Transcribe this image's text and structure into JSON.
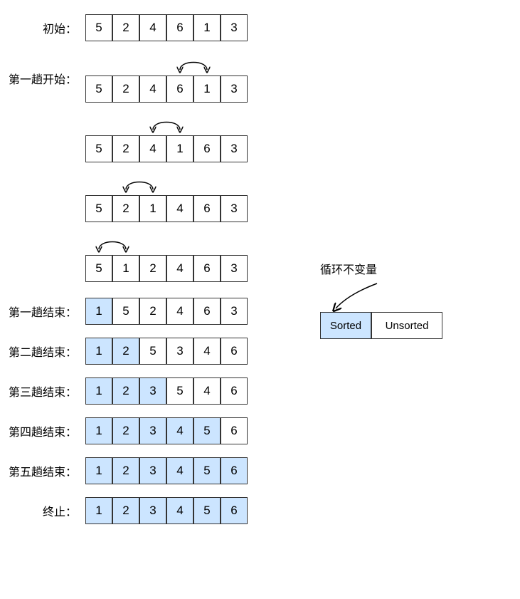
{
  "labels": {
    "initial": "初始：",
    "pass1_start": "第一趟开始：",
    "pass1_end": "第一趟结束：",
    "pass2_end": "第二趟结束：",
    "pass3_end": "第三趟结束：",
    "pass4_end": "第四趟结束：",
    "pass5_end": "第五趟结束：",
    "final": "终止："
  },
  "arrays": {
    "initial": [
      5,
      2,
      4,
      6,
      1,
      3
    ],
    "pass1_step1_before": [
      5,
      2,
      4,
      6,
      1,
      3
    ],
    "pass1_step2": [
      5,
      2,
      4,
      1,
      6,
      3
    ],
    "pass1_step3": [
      5,
      2,
      1,
      4,
      6,
      3
    ],
    "pass1_step4": [
      5,
      1,
      2,
      4,
      6,
      3
    ],
    "pass1_end": [
      1,
      5,
      2,
      4,
      6,
      3
    ],
    "pass2_end": [
      1,
      2,
      5,
      3,
      4,
      6
    ],
    "pass3_end": [
      1,
      2,
      3,
      5,
      4,
      6
    ],
    "pass4_end": [
      1,
      2,
      3,
      4,
      5,
      6
    ],
    "pass5_end": [
      1,
      2,
      3,
      4,
      5,
      6
    ],
    "final": [
      1,
      2,
      3,
      4,
      5,
      6
    ]
  },
  "sorted_counts": {
    "initial": 0,
    "pass1_step1": 0,
    "pass1_step2": 0,
    "pass1_step3": 0,
    "pass1_step4": 0,
    "pass1_end": 1,
    "pass2_end": 2,
    "pass3_end": 3,
    "pass4_end": 5,
    "pass5_end": 6,
    "final": 6
  },
  "legend": {
    "title": "循环不变量",
    "sorted_label": "Sorted",
    "unsorted_label": "Unsorted"
  },
  "colors": {
    "sorted_bg": "#cce5ff",
    "unsorted_bg": "#ffffff",
    "border": "#333333"
  }
}
